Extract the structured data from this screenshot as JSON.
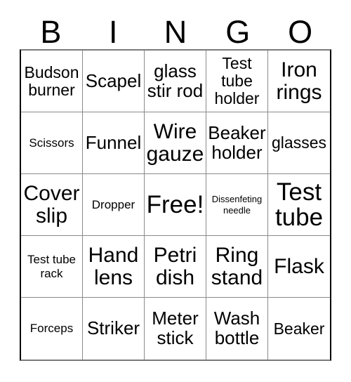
{
  "header": {
    "letters": [
      "B",
      "I",
      "N",
      "G",
      "O"
    ]
  },
  "grid": {
    "columns": 5,
    "rows": 5,
    "cells": [
      {
        "text": "Budson burner",
        "size": "md"
      },
      {
        "text": "Scapel",
        "size": "lg"
      },
      {
        "text": "glass stir rod",
        "size": "lg"
      },
      {
        "text": "Test tube holder",
        "size": "md"
      },
      {
        "text": "Iron rings",
        "size": "xl"
      },
      {
        "text": "Scissors",
        "size": "sm"
      },
      {
        "text": "Funnel",
        "size": "lg"
      },
      {
        "text": "Wire gauze",
        "size": "xl"
      },
      {
        "text": "Beaker holder",
        "size": "lg"
      },
      {
        "text": "glasses",
        "size": "md"
      },
      {
        "text": "Cover slip",
        "size": "xl"
      },
      {
        "text": "Dropper",
        "size": "sm"
      },
      {
        "text": "Free!",
        "size": "xxl"
      },
      {
        "text": "Dissenfeting needle",
        "size": "xs"
      },
      {
        "text": "Test tube",
        "size": "xxl"
      },
      {
        "text": "Test tube rack",
        "size": "sm"
      },
      {
        "text": "Hand lens",
        "size": "xl"
      },
      {
        "text": "Petri dish",
        "size": "xl"
      },
      {
        "text": "Ring stand",
        "size": "xl"
      },
      {
        "text": "Flask",
        "size": "xl"
      },
      {
        "text": "Forceps",
        "size": "sm"
      },
      {
        "text": "Striker",
        "size": "lg"
      },
      {
        "text": "Meter stick",
        "size": "lg"
      },
      {
        "text": "Wash bottle",
        "size": "lg"
      },
      {
        "text": "Beaker",
        "size": "md"
      }
    ]
  },
  "colors": {
    "background": "#ffffff",
    "text": "#000000",
    "grid_line": "#8a8a8a",
    "grid_border": "#000000"
  }
}
